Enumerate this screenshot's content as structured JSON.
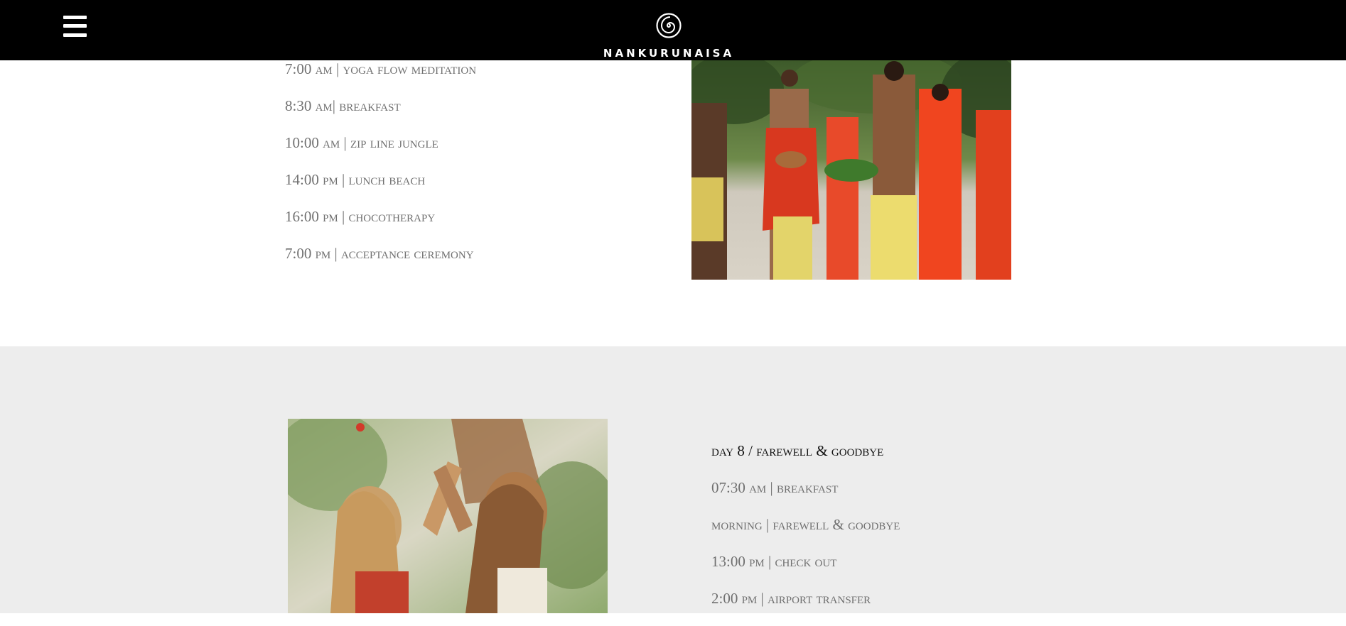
{
  "header": {
    "brand": "NANKURUNAISA",
    "menu_icon": "hamburger-menu-icon",
    "logo_icon": "spiral-logo-icon",
    "background_color": "#000000"
  },
  "day_schedule": [
    "7:00 am | yoga flow meditation",
    "8:30 am| breakfast",
    "10:00 am | zip line jungle",
    "14:00 pm | lunch beach",
    "16:00 pm | chocotherapy",
    "7:00 pm | acceptance ceremony"
  ],
  "day8": {
    "title": "day 8 / farewell & goodbye",
    "items": [
      "07:30 am | breakfast",
      "morning | farewell & goodbye",
      "13:00 pm | check out",
      "2:00 pm | airport transfer"
    ]
  },
  "colors": {
    "text_gray": "#707070",
    "section_gray": "#ededed"
  }
}
